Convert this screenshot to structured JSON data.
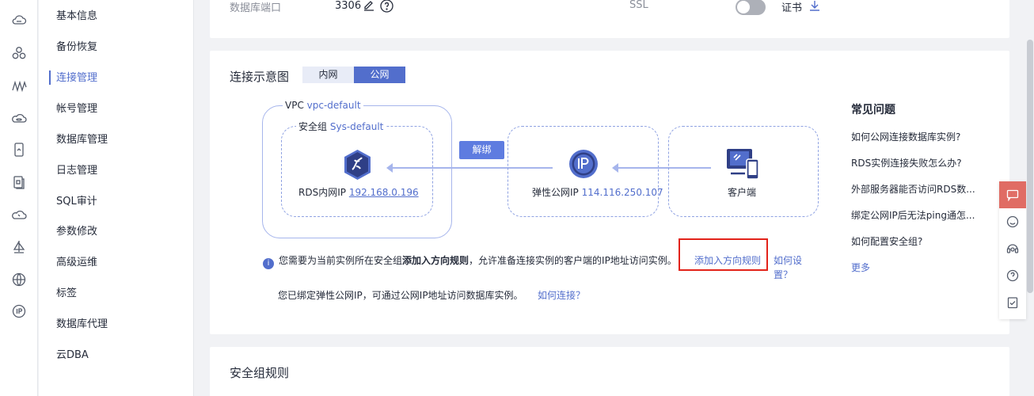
{
  "rail_icons": [
    "cloud-icon",
    "cluster-icon",
    "signal-icon",
    "database-cloud-icon",
    "storage-icon",
    "document-icon",
    "cloud-outline-icon",
    "sailboat-icon",
    "globe-icon",
    "ip-icon"
  ],
  "nav": {
    "items": [
      {
        "label": "基本信息"
      },
      {
        "label": "备份恢复"
      },
      {
        "label": "连接管理"
      },
      {
        "label": "帐号管理"
      },
      {
        "label": "数据库管理"
      },
      {
        "label": "日志管理"
      },
      {
        "label": "SQL审计"
      },
      {
        "label": "参数修改"
      },
      {
        "label": "高级运维"
      },
      {
        "label": "标签"
      },
      {
        "label": "数据库代理"
      },
      {
        "label": "云DBA"
      }
    ],
    "active_index": 2
  },
  "top_card": {
    "port_label": "数据库端口",
    "port_value": "3306",
    "ssl_label": "SSL",
    "cert_label": "证书"
  },
  "connection": {
    "title": "连接示意图",
    "tabs": [
      "内网",
      "公网"
    ],
    "active_tab": 1,
    "vpc_label": "VPC",
    "vpc_name": "vpc-default",
    "sg_label": "安全组",
    "sg_name": "Sys-default",
    "rds_ip_label": "RDS内网IP",
    "rds_ip": "192.168.0.196",
    "unbind_label": "解绑",
    "eip_label": "弹性公网IP",
    "eip": "114.116.250.107",
    "client_label": "客户端",
    "notice_pre": "您需要为当前实例所在安全组",
    "notice_bold": "添加入方向规则",
    "notice_post": "，允许准备连接实例的客户端的IP地址访问实例。",
    "add_rule_link": "添加入方向规则",
    "how_to_set_link": "如何设置？",
    "bound_text": "您已绑定弹性公网IP，可通过公网IP地址访问数据库实例。",
    "how_connect_link": "如何连接？"
  },
  "faq": {
    "title": "常见问题",
    "questions": [
      "如何公网连接数据库实例?",
      "RDS实例连接失败怎么办?",
      "外部服务器能否访问RDS数...",
      "绑定公网IP后无法ping通怎...",
      "如何配置安全组?"
    ],
    "more": "更多"
  },
  "security_rules": {
    "title": "安全组规则"
  },
  "float_icons": [
    "message-icon",
    "smiley-icon",
    "headset-icon",
    "help-icon",
    "checklist-icon"
  ]
}
